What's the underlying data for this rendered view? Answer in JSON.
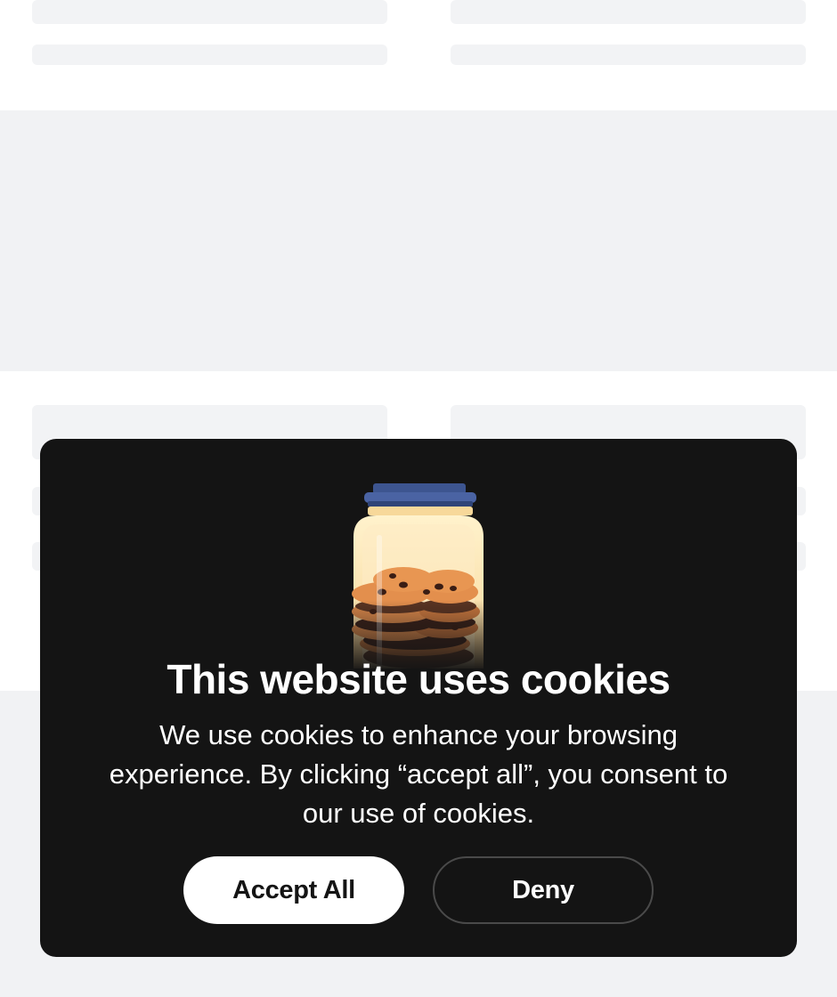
{
  "cookie_banner": {
    "title": "This website uses cookies",
    "message": "We use cookies to enhance your browsing experience. By clicking “accept all”, you consent to our use of cookies.",
    "accept_label": "Accept All",
    "deny_label": "Deny",
    "image_icon": "cookie-jar-icon"
  },
  "colors": {
    "banner_background": "#141414",
    "page_background": "#ffffff",
    "skeleton": "#f2f3f5",
    "accept_button_bg": "#ffffff",
    "deny_button_border": "#4a4a4a"
  }
}
